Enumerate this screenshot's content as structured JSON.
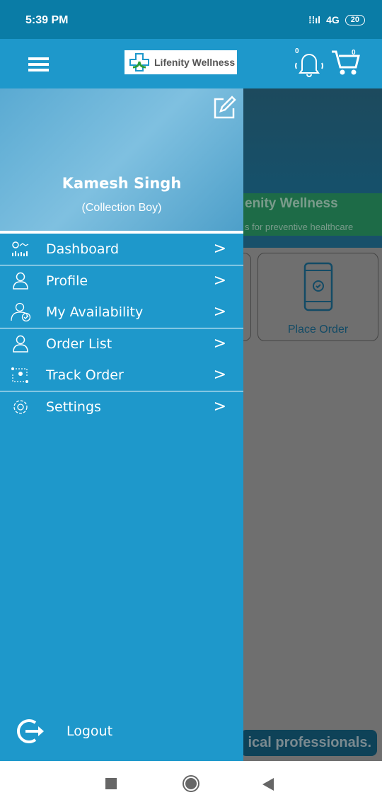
{
  "status_bar": {
    "time": "5:39 PM",
    "network": "4G",
    "battery": "20"
  },
  "app_bar": {
    "logo_text": "Lifenity Wellness",
    "notification_count": "0",
    "cart_count": "0"
  },
  "background": {
    "banner_title": "enity Wellness",
    "banner_subtitle": "s for preventive healthcare",
    "card_label": "Place Order",
    "footer_text": "ical professionals."
  },
  "drawer": {
    "user_name": "Kamesh Singh",
    "user_role": "(Collection Boy)",
    "items": [
      {
        "label": "Dashboard",
        "icon": "dashboard-icon"
      },
      {
        "label": "Profile",
        "icon": "user-icon"
      },
      {
        "label": "My Availability",
        "icon": "availability-icon"
      },
      {
        "label": "Order List",
        "icon": "user-icon"
      },
      {
        "label": "Track Order",
        "icon": "track-icon"
      },
      {
        "label": "Settings",
        "icon": "gear-icon"
      }
    ],
    "logout_label": "Logout"
  },
  "colors": {
    "primary": "#1e98cb",
    "status_bar": "#0a7ca6"
  }
}
